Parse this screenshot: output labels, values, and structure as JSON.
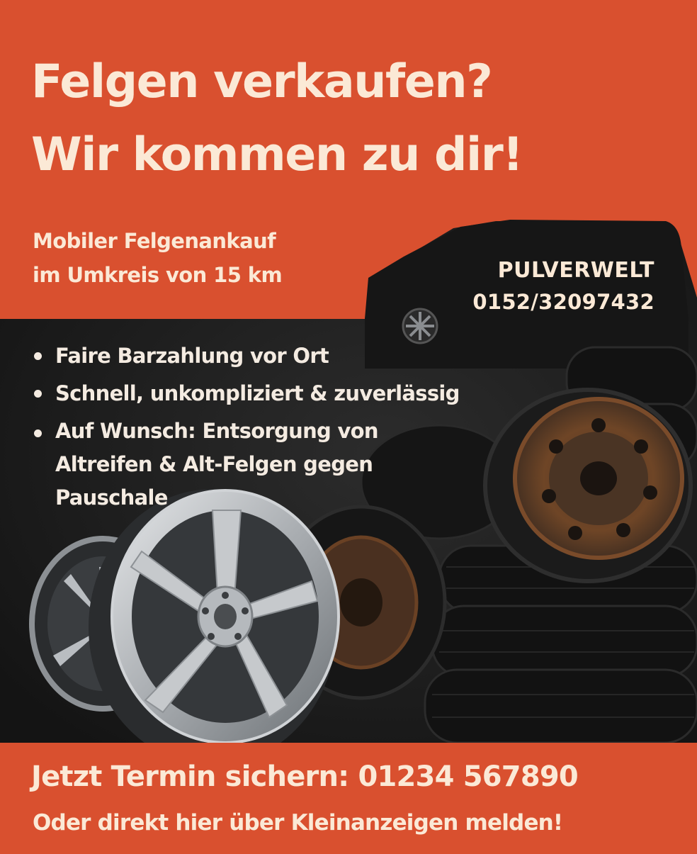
{
  "headline": {
    "line1": "Felgen verkaufen?",
    "line2": "Wir kommen zu dir!"
  },
  "subline": {
    "line1": "Mobiler Felgenankauf",
    "line2": "im Umkreis von 15 km"
  },
  "company": {
    "name": "PULVERWELT",
    "phone": "0152/32097432"
  },
  "bullets": [
    "Faire Barzahlung vor Ort",
    "Schnell, unkompliziert & zuverlässig",
    "Auf Wunsch: Entsorgung von Altreifen & Alt-Felgen gegen Pauschale"
  ],
  "cta": {
    "line1": "Jetzt Termin sichern: 01234 567890",
    "line2": "Oder direkt hier über Kleinanzeigen melden!"
  },
  "colors": {
    "accent": "#d9502f",
    "text_light": "#fbe9d6",
    "photo_dark": "#1a1a1a"
  }
}
